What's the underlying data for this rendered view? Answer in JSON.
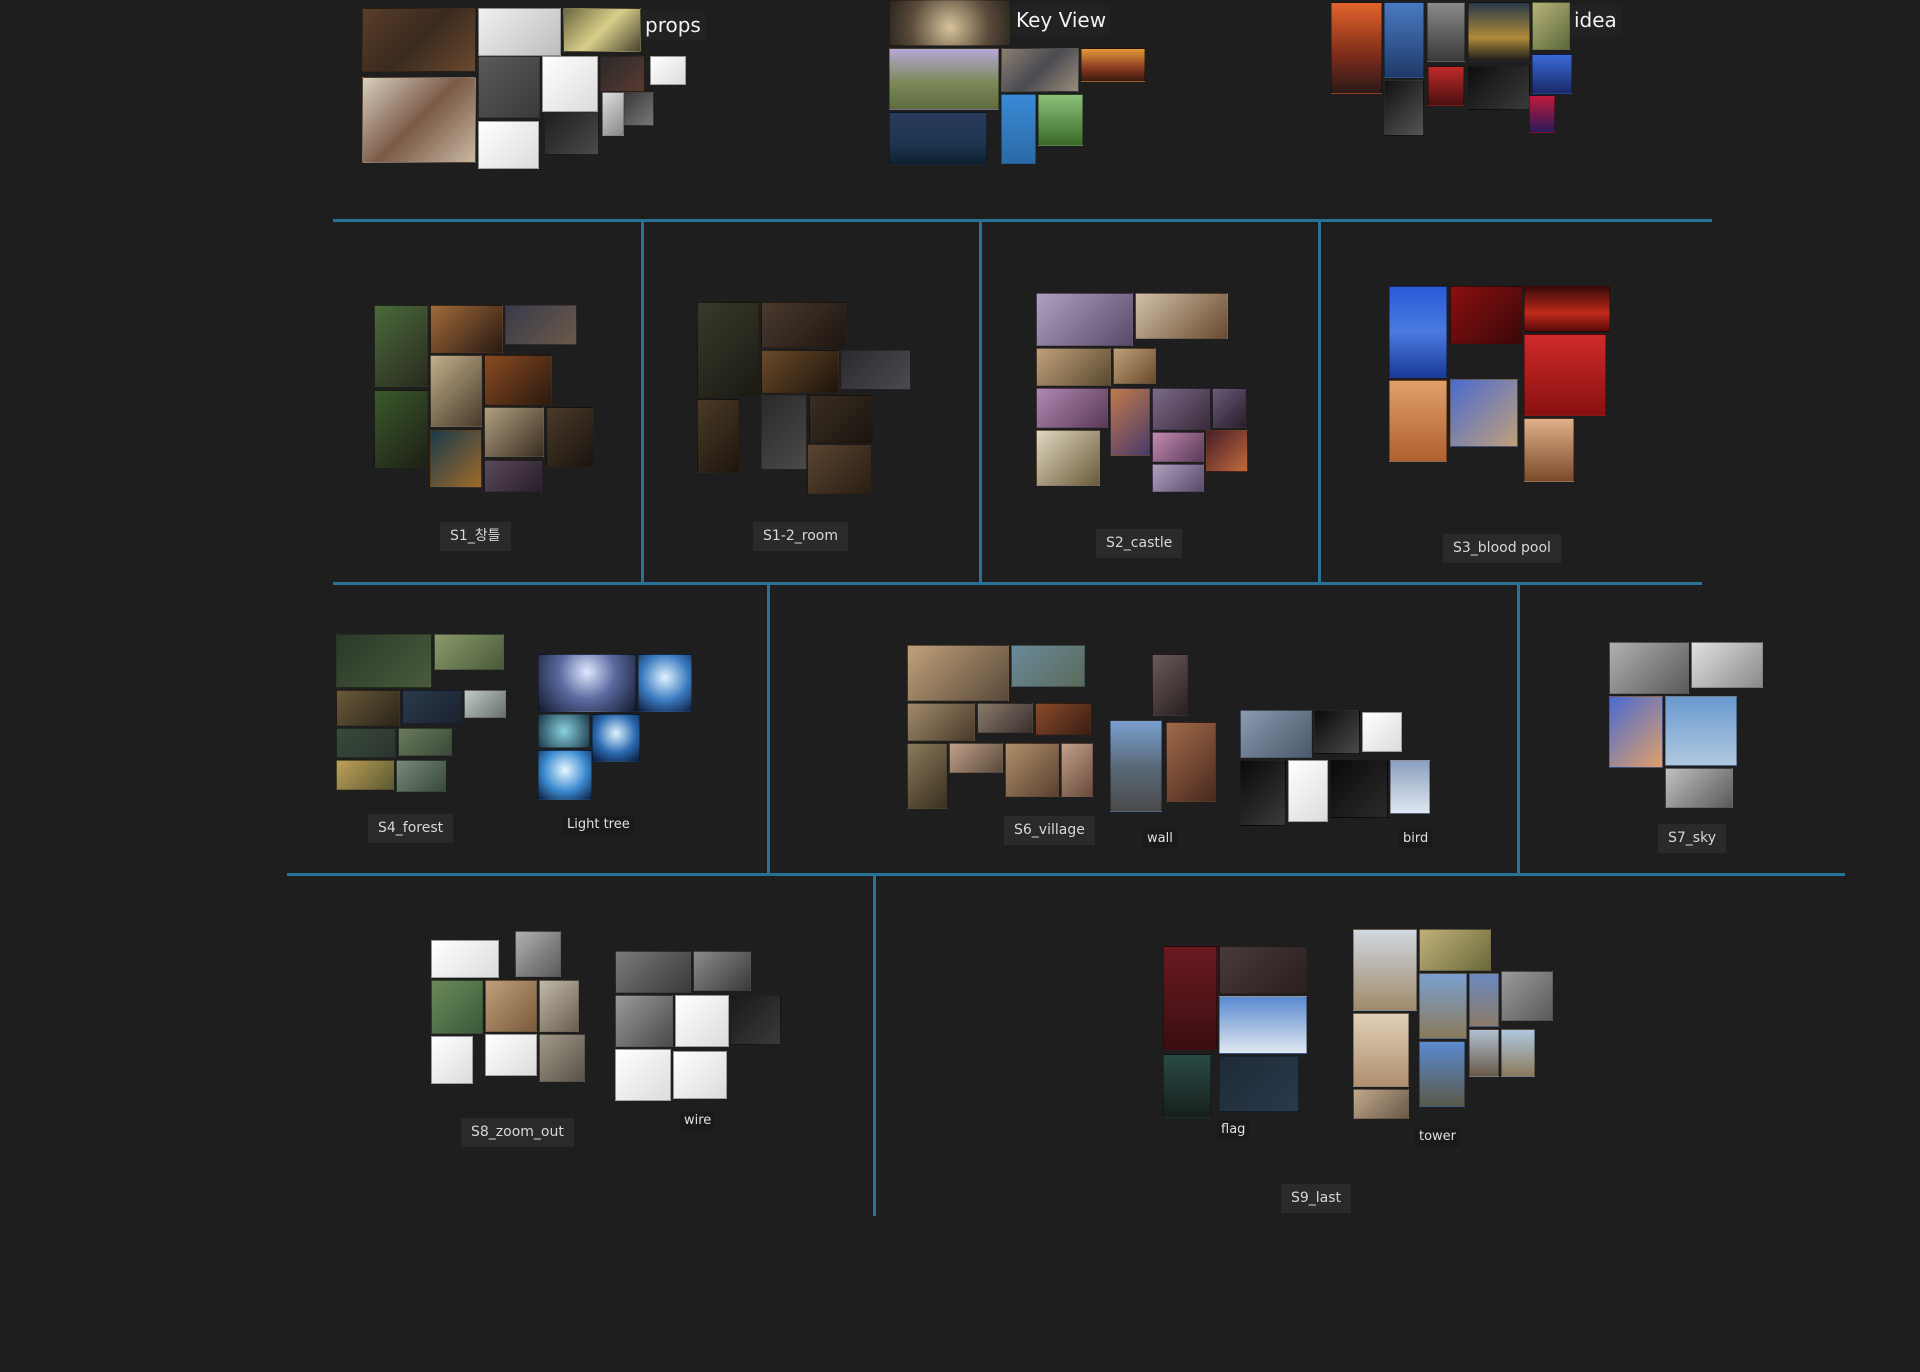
{
  "board": {
    "section_titles": {
      "props": "props",
      "key_view": "Key View",
      "idea": "idea"
    },
    "scenes": {
      "s1": "S1_창틀",
      "s1_2": "S1-2_room",
      "s2": "S2_castle",
      "s3": "S3_blood pool",
      "s4": "S4_forest",
      "light_tree": "Light tree",
      "s6": "S6_village",
      "wall": "wall",
      "bird": "bird",
      "s7": "S7_sky",
      "s8": "S8_zoom_out",
      "wire": "wire",
      "flag": "flag",
      "tower": "tower",
      "s9": "S9_last"
    }
  },
  "colors": {
    "background": "#1e1e1e",
    "divider": "#2a7196",
    "label_bg": "#2a2a2a",
    "label_text": "#d8d8d8"
  }
}
